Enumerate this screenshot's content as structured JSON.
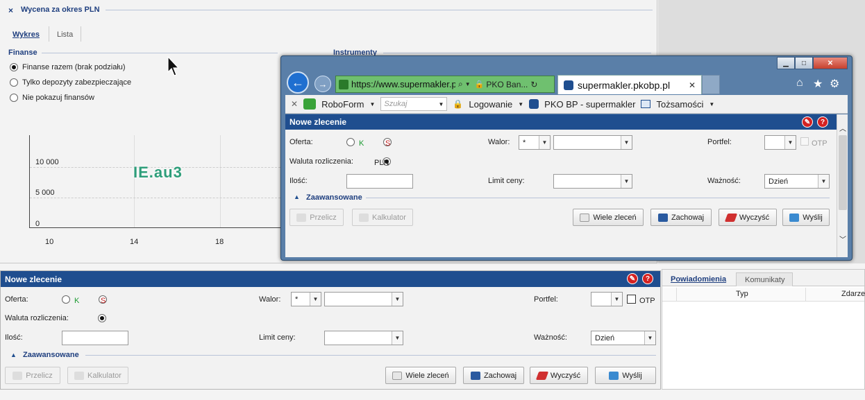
{
  "valuation": {
    "title": "Wycena za okres PLN",
    "close": "×",
    "tabs": [
      {
        "label": "Wykres"
      },
      {
        "label": "Lista"
      }
    ],
    "finanse_label": "Finanse",
    "instrumenty_label": "Instrumenty",
    "radios": [
      {
        "label": "Finanse razem (brak podziału)",
        "checked": true
      },
      {
        "label": "Tylko depozyty zabezpieczające",
        "checked": false
      },
      {
        "label": "Nie pokazuj finansów",
        "checked": false
      }
    ]
  },
  "chart_data": {
    "type": "line",
    "y_ticks": [
      "10 000",
      "5 000",
      "0"
    ],
    "x_ticks": [
      "10",
      "14",
      "18"
    ],
    "series": []
  },
  "overlay_text": "IE.au3",
  "browser": {
    "url": "https://www.supermakler.p",
    "site_tab": "PKO Ban...",
    "tab_title": "supermakler.pkobp.pl",
    "roboform": "RoboForm",
    "search_placeholder": "Szukaj",
    "logowanie": "Logowanie",
    "pko_link": "PKO BP - supermakler",
    "tozsamosci": "Tożsamości"
  },
  "order_form": {
    "title": "Nowe zlecenie",
    "oferta": "Oferta:",
    "k": "K",
    "s": "S",
    "walor": "Walor:",
    "walor_value": "*",
    "portfel": "Portfel:",
    "otp": "OTP",
    "waluta": "Waluta rozliczenia:",
    "pln": "PLN",
    "ilosc": "Ilość:",
    "limit": "Limit ceny:",
    "waznosc": "Ważność:",
    "waznosc_value": "Dzień",
    "advanced": "Zaawansowane",
    "btn_przelicz": "Przelicz",
    "btn_kalkulator": "Kalkulator",
    "btn_wiele": "Wiele zleceń",
    "btn_zachowaj": "Zachowaj",
    "btn_wyczysc": "Wyczyść",
    "btn_wyslij": "Wyślij"
  },
  "notifications": {
    "tabs": [
      {
        "label": "Powiadomienia"
      },
      {
        "label": "Komunikaty"
      }
    ],
    "columns": [
      "Typ",
      "Zdarze"
    ]
  }
}
